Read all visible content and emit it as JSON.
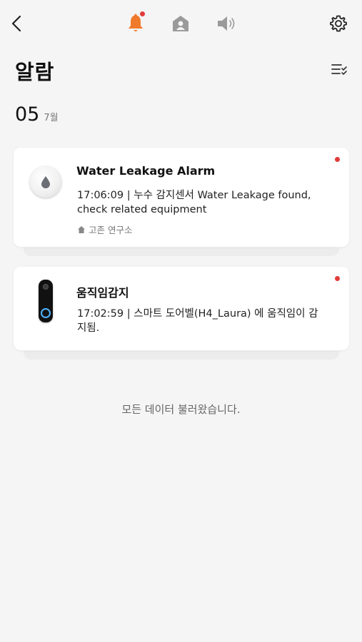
{
  "header": {
    "icons": [
      "back-icon",
      "bell-icon",
      "home-icon",
      "speaker-icon",
      "gear-icon"
    ],
    "bell_has_notification": true
  },
  "page": {
    "title": "알람",
    "filter_icon": "checklist-filter-icon"
  },
  "date_group": {
    "day": "05",
    "month": "7월"
  },
  "alarms": [
    {
      "title": "Water Leakage Alarm",
      "body": "17:06:09 | 누수 감지센서  Water Leakage found, check related equipment",
      "location": "고존 연구소",
      "device_icon": "water-leak-sensor-icon",
      "unread": true
    },
    {
      "title": "움직임감지",
      "body": "17:02:59 | 스마트 도어벨(H4_Laura) 에 움직임이 감지됨.",
      "device_icon": "smart-doorbell-icon",
      "unread": true
    }
  ],
  "footer": {
    "text": "모든 데이터 불러왔습니다."
  },
  "colors": {
    "accent": "#f07a2c",
    "unread_dot": "#e23b3b",
    "background": "#f5f5f5",
    "card": "#ffffff",
    "inactive_icon": "#9a9a9a"
  }
}
